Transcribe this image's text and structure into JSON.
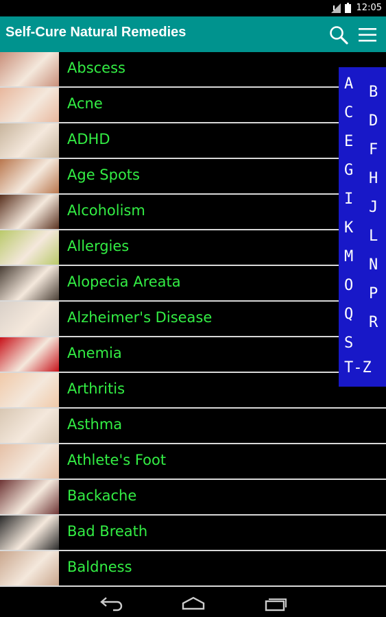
{
  "status_bar": {
    "time": "12:05"
  },
  "app": {
    "title": "Self-Cure Natural Remedies"
  },
  "colors": {
    "action_bar": "#00938e",
    "index_bg": "#1818c8",
    "item_text": "#33ee44"
  },
  "list": {
    "items": [
      {
        "label": "Abscess",
        "thumb_color": "#c98f7a"
      },
      {
        "label": "Acne",
        "thumb_color": "#e8b79d"
      },
      {
        "label": "ADHD",
        "thumb_color": "#c7b49c"
      },
      {
        "label": "Age Spots",
        "thumb_color": "#b9774e"
      },
      {
        "label": "Alcoholism",
        "thumb_color": "#5a3220"
      },
      {
        "label": "Allergies",
        "thumb_color": "#b9c96a"
      },
      {
        "label": "Alopecia Areata",
        "thumb_color": "#4a3f36"
      },
      {
        "label": "Alzheimer's Disease",
        "thumb_color": "#d9d0c8"
      },
      {
        "label": "Anemia",
        "thumb_color": "#c8121a"
      },
      {
        "label": "Arthritis",
        "thumb_color": "#f0c9a8"
      },
      {
        "label": "Asthma",
        "thumb_color": "#d8c7b3"
      },
      {
        "label": "Athlete's Foot",
        "thumb_color": "#e5bfa5"
      },
      {
        "label": "Backache",
        "thumb_color": "#6e3535"
      },
      {
        "label": "Bad Breath",
        "thumb_color": "#2b2b2b"
      },
      {
        "label": "Baldness",
        "thumb_color": "#c9a68d"
      }
    ]
  },
  "index": {
    "letters": [
      "A",
      "B",
      "C",
      "D",
      "E",
      "F",
      "G",
      "H",
      "I",
      "J",
      "K",
      "L",
      "M",
      "N",
      "O",
      "P",
      "Q",
      "R",
      "S",
      "T-Z"
    ]
  },
  "icons": [
    "search-icon",
    "menu-icon",
    "back-icon",
    "home-icon",
    "recent-apps-icon"
  ]
}
